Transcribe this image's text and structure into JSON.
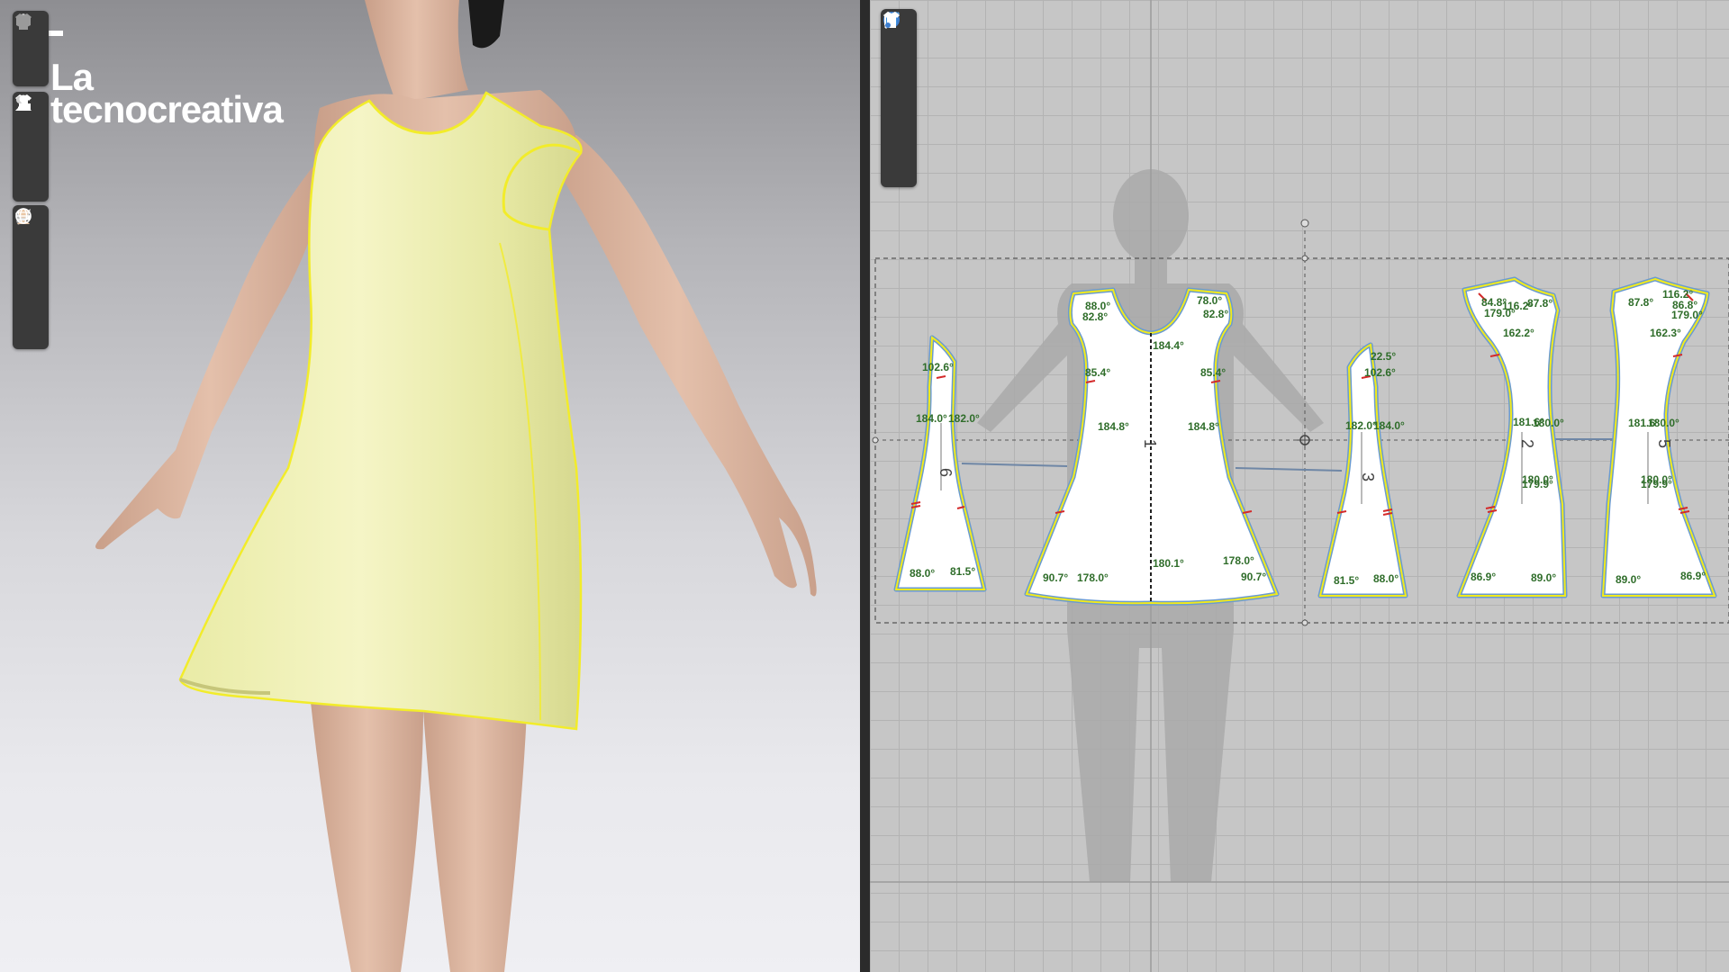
{
  "logo": {
    "line1": "La",
    "line2": "tecnocreativa"
  },
  "toolbar_3d": [
    [
      "simulation-icon",
      "garment-display-icon"
    ],
    [
      "garment-icon",
      "arrangement-icon",
      "avatar-icon"
    ],
    [
      "texture-icon",
      "fabric-icon",
      "skin-icon",
      "globe-icon"
    ]
  ],
  "toolbar_2d": [
    "edit-pattern-icon",
    "garment-icon",
    "info-icon",
    "fabric-piece-icon",
    "garment-icon"
  ],
  "pattern_pieces": [
    {
      "id": "piece-6",
      "number": "6",
      "angles": [
        "102.6°",
        "184.0°",
        "182.0°",
        "88.0°",
        "81.5°"
      ]
    },
    {
      "id": "piece-1",
      "number": "1",
      "angles": [
        "88.0°",
        "82.8°",
        "78.0°",
        "82.8°",
        "184.4°",
        "85.4°",
        "85.4°",
        "184.8°",
        "184.8°",
        "180.1°",
        "90.7°",
        "178.0°",
        "178.0°",
        "90.7°"
      ]
    },
    {
      "id": "piece-3",
      "number": "3",
      "angles": [
        "22.5°",
        "102.6°",
        "182.0°",
        "184.0°",
        "81.5°",
        "88.0°"
      ]
    },
    {
      "id": "piece-2",
      "number": "2",
      "angles": [
        "84.8°",
        "116.2°",
        "87.8°",
        "179.0°",
        "162.2°",
        "181.6°",
        "180.0°",
        "180.0°",
        "179.9°",
        "86.9°",
        "89.0°"
      ]
    },
    {
      "id": "piece-5",
      "number": "5",
      "angles": [
        "87.8°",
        "116.2°",
        "86.8°",
        "179.0°",
        "162.3°",
        "181.6°",
        "180.0°",
        "180.0°",
        "179.9°",
        "89.0°",
        "86.9°"
      ]
    }
  ]
}
